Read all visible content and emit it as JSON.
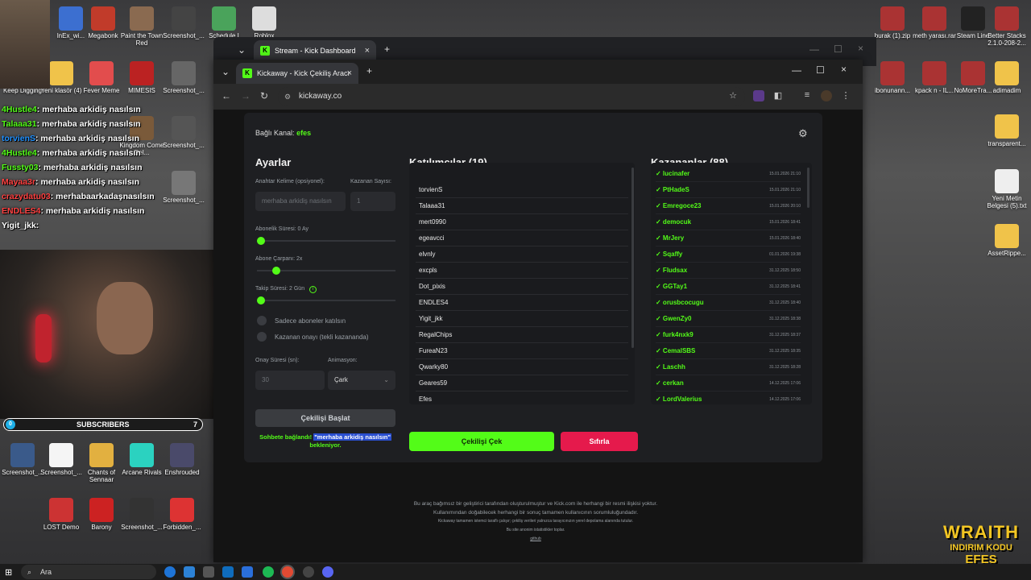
{
  "desktop": {
    "icons_left": [
      {
        "label": "lnEx_wi...",
        "color": "#3c6fd0"
      },
      {
        "label": "Megabonk",
        "color": "#c13b2a"
      },
      {
        "label": "Paint the Town Red",
        "color": "#8a6a50"
      },
      {
        "label": "Screenshot_...",
        "color": "#444"
      },
      {
        "label": "Schedule I",
        "color": "#4aa35b"
      },
      {
        "label": "Roblox",
        "color": "#ddd"
      },
      {
        "label": "Keep Digging",
        "color": "#5a8ab0"
      },
      {
        "label": "Yeni klasör (4)",
        "color": "#f0c34a"
      },
      {
        "label": "Fever Meme",
        "color": "#e24d4d"
      },
      {
        "label": "MIMESIS",
        "color": "#b22"
      },
      {
        "label": "Screenshot_...",
        "color": "#666"
      },
      {
        "label": "Kingdom Come Del...",
        "color": "#7a5a3a"
      },
      {
        "label": "Screenshot_...",
        "color": "#555"
      },
      {
        "label": "Screenshot_...",
        "color": "#777"
      },
      {
        "label": "Screenshot_...",
        "color": "#3a5a8a"
      },
      {
        "label": "Screenshot_...",
        "color": "#f5f5f5"
      },
      {
        "label": "Arcane Rivals",
        "color": "#2bd2c0"
      },
      {
        "label": "Enshrouded",
        "color": "#4a4a6a"
      },
      {
        "label": "Chants of Sennaar",
        "color": "#e2b040"
      },
      {
        "label": "LOST Demo",
        "color": "#c33"
      },
      {
        "label": "Barony",
        "color": "#c22"
      },
      {
        "label": "Screenshot_...",
        "color": "#333"
      },
      {
        "label": "Forbidden_...",
        "color": "#d33"
      }
    ],
    "icons_right": [
      {
        "label": "burak (1).zip",
        "color": "#a33"
      },
      {
        "label": "meth yarası.rar",
        "color": "#a33"
      },
      {
        "label": "Steam Line",
        "color": "#222"
      },
      {
        "label": "Better Stacks 2.1.0-208-2...",
        "color": "#a33"
      },
      {
        "label": "ibonunann...",
        "color": "#a33"
      },
      {
        "label": "kpack n - IL...",
        "color": "#a33"
      },
      {
        "label": "NoMoreTra...",
        "color": "#a33"
      },
      {
        "label": "adimadim",
        "color": "#f0c34a"
      },
      {
        "label": "transparent...",
        "color": "#f0c34a"
      },
      {
        "label": "Yeni Metin Belgesi (5).txt",
        "color": "#eee"
      },
      {
        "label": "AssetRippe...",
        "color": "#f0c34a"
      },
      {
        "label": "AssetRippe...",
        "color": "#a33"
      }
    ]
  },
  "chat": [
    {
      "user": "4Hustle4",
      "msg": ": merhaba arkidiş nasılsın",
      "color": "#53fc18"
    },
    {
      "user": "Talaaa31",
      "msg": ": merhaba arkidiş nasılsın",
      "color": "#53fc18"
    },
    {
      "user": "torvienS",
      "msg": ": merhaba arkidiş nasılsın",
      "color": "#1e90ff"
    },
    {
      "user": "4Hustle4",
      "msg": ": merhaba arkidiş nasılsın",
      "color": "#53fc18"
    },
    {
      "user": "Fussty03",
      "msg": ": merhaba arkidiş nasılsın",
      "color": "#53fc18"
    },
    {
      "user": "Mayaa3r",
      "msg": ": merhaba arkidiş nasılsın",
      "color": "#ff4040"
    },
    {
      "user": "crazydatu03",
      "msg": ": merhabaarkadaşnasılsın",
      "color": "#ff4040"
    },
    {
      "user": "ENDLES4",
      "msg": ": merhaba arkidiş nasılsın",
      "color": "#ff4040"
    },
    {
      "user": "Yigit_jkk",
      "msg": ":",
      "color": "#fff"
    }
  ],
  "subscribers": {
    "label": "SUBSCRIBERS",
    "count": "7"
  },
  "promo": {
    "line1": "WRAITH",
    "line2": "INDIRIM KODU",
    "line3": "EFES"
  },
  "browser_back": {
    "tab_label": "Stream - Kick Dashboard"
  },
  "browser": {
    "tab_label": "Kickaway - Kick Çekiliş Aracı",
    "url": "kickaway.co"
  },
  "app": {
    "channel_label": "Bağlı Kanal:",
    "channel_name": "efes",
    "settings": {
      "title": "Ayarlar",
      "keyword_label": "Anahtar Kelime (opsiyonel):",
      "keyword_placeholder": "merhaba arkidiş nasılsın",
      "winners_label": "Kazanan Sayısı:",
      "winners_placeholder": "1",
      "sub_duration_label": "Abonelik Süresi: 0 Ay",
      "sub_duration_value": 0,
      "sub_multiplier_label": "Abone Çarpanı: 2x",
      "sub_multiplier_value": 0.12,
      "follow_duration_label": "Takip Süresi: 2 Gün",
      "follow_duration_value": 0,
      "only_subs_label": "Sadece aboneler katılsın",
      "winner_confirm_label": "Kazanan onayı (tekli kazananda)",
      "confirm_time_label": "Onay Süresi (sn):",
      "confirm_time_placeholder": "30",
      "animation_label": "Animasyon:",
      "animation_value": "Çark",
      "start_button": "Çekilişi Başlat",
      "status_prefix": "Sohbete bağlandı!",
      "status_keyword": "\"merhaba arkidiş nasılsın\"",
      "status_suffix": "bekleniyor."
    },
    "participants": {
      "title": "Katılımcılar (19)",
      "items": [
        "torvienS",
        "Talaaa31",
        "mert0990",
        "egeavcci",
        "elvnly",
        "excpls",
        "Dot_pixis",
        "ENDLES4",
        "Yigit_jkk",
        "RegalChips",
        "FureaN23",
        "Qwarky80",
        "Geares59",
        "Efes"
      ]
    },
    "winners": {
      "title": "Kazananlar (88)",
      "items": [
        {
          "name": "lucinafer",
          "date": "15.01.2026 21:10"
        },
        {
          "name": "PtHadeS",
          "date": "15.01.2026 21:10"
        },
        {
          "name": "Emregoce23",
          "date": "15.01.2026 20:10"
        },
        {
          "name": "democuk",
          "date": "15.01.2026 18:41"
        },
        {
          "name": "MrJery",
          "date": "15.01.2026 18:40"
        },
        {
          "name": "Sqaffy",
          "date": "01.01.2026 19:38"
        },
        {
          "name": "Fludsax",
          "date": "31.12.2025 18:50"
        },
        {
          "name": "GGTay1",
          "date": "31.12.2025 18:41"
        },
        {
          "name": "orusbcocugu",
          "date": "31.12.2025 18:40"
        },
        {
          "name": "GwenZy0",
          "date": "31.12.2025 18:38"
        },
        {
          "name": "furk4nxk9",
          "date": "31.12.2025 18:37"
        },
        {
          "name": "CemalSBS",
          "date": "31.12.2025 18:35"
        },
        {
          "name": "Laschh",
          "date": "31.12.2025 18:28"
        },
        {
          "name": "cerkan",
          "date": "14.12.2025 17:06"
        },
        {
          "name": "LordValerius",
          "date": "14.12.2025 17:06"
        }
      ]
    },
    "draw_button": "Çekilişi Çek",
    "reset_button": "Sıfırla",
    "footer": [
      "Bu araç bağımsız bir geliştirici tarafından oluşturulmuştur ve Kick.com ile herhangi bir resmi ilişkisi yoktur.",
      "Kullanımından doğabilecek herhangi bir sonuç tamamen kullanıcının sorumluluğundadır.",
      "Kickaway tamamen istemci taraflı çalışır; çekiliş verileri yalnızca tarayıcınızın yerel depolama alanında tutulur.",
      "Bu site anonim istatistikler toplar.",
      "github"
    ]
  },
  "taskbar": {
    "search_placeholder": "Ara"
  },
  "colors": {
    "accent": "#53fc18",
    "danger": "#e51a4c"
  }
}
